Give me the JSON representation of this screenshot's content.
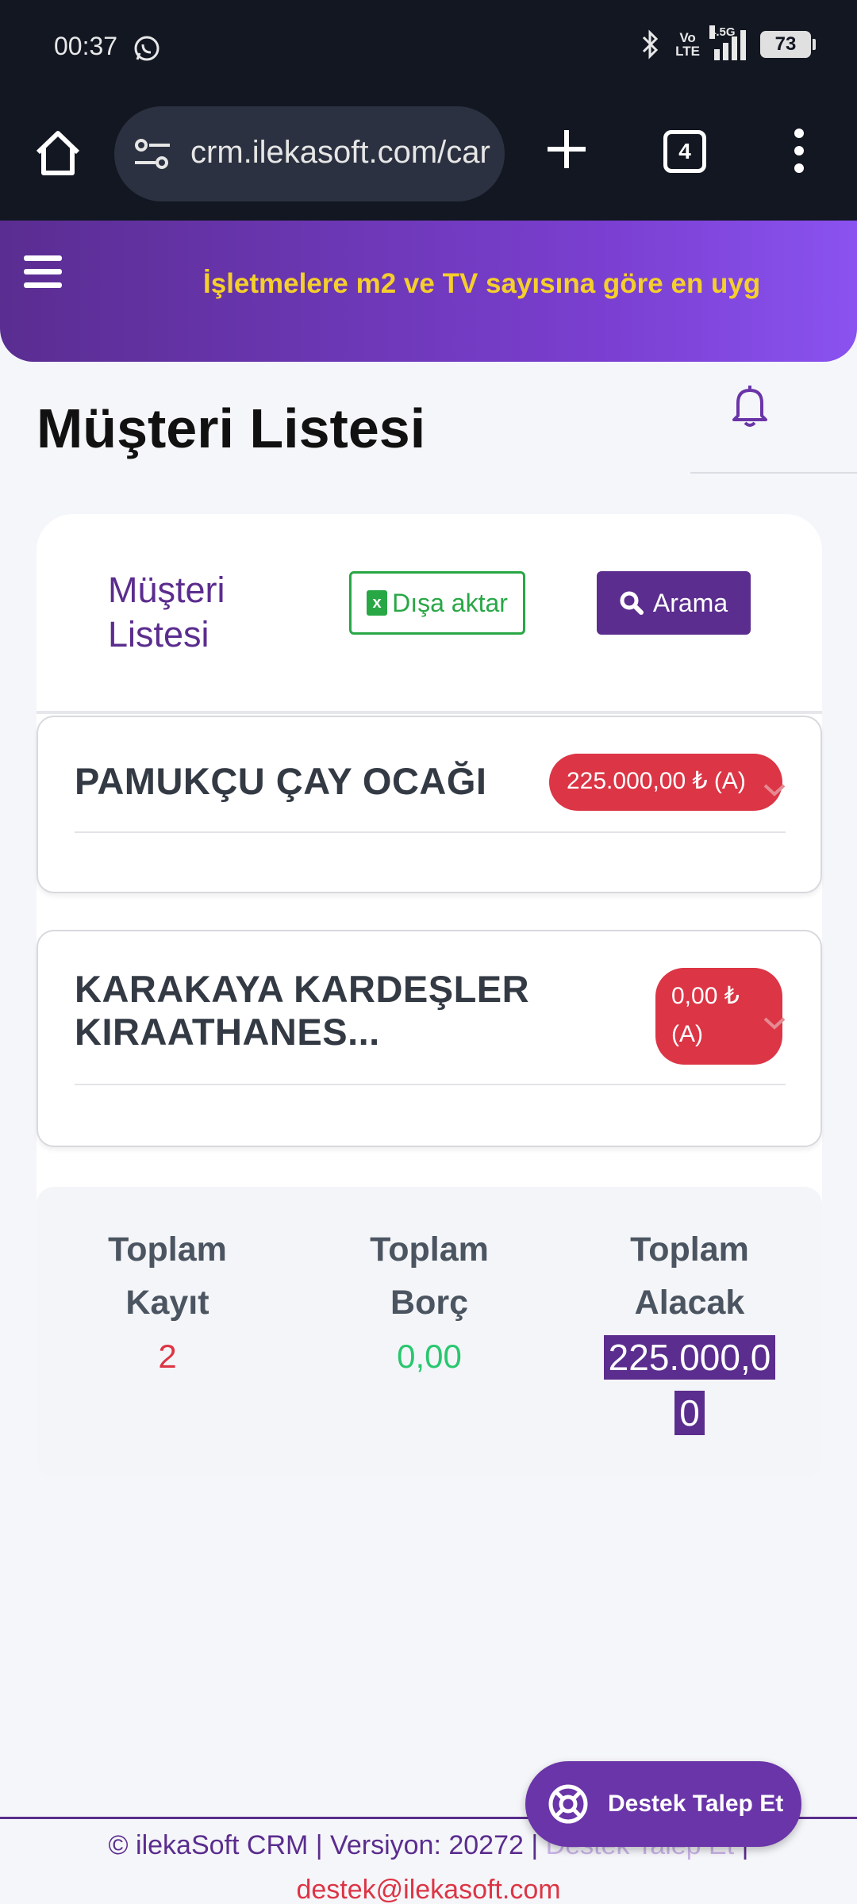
{
  "status_bar": {
    "time": "00:37",
    "volte_top": "Vo",
    "volte_bottom": "LTE",
    "network": "4.5G",
    "battery": "73"
  },
  "browser": {
    "url": "crm.ilekasoft.com/car",
    "tab_count": "4"
  },
  "header": {
    "marquee": "İşletmelere m2 ve TV sayısına göre en uyg"
  },
  "page": {
    "title": "Müşteri Listesi"
  },
  "card": {
    "title": "Müşteri Listesi",
    "export_label": "Dışa aktar",
    "search_label": "Arama"
  },
  "customers": [
    {
      "name": "PAMUKÇU ÇAY OCAĞI",
      "balance": "225.000,00 ₺ (A)"
    },
    {
      "name": "KARAKAYA KARDEŞLER KIRAATHANES...",
      "balance": "0,00 ₺ (A)"
    }
  ],
  "summary": {
    "records_label": "Toplam Kayıt",
    "records_value": "2",
    "debt_label": "Toplam Borç",
    "debt_value": "0,00",
    "credit_label": "Toplam Alacak",
    "credit_value": "225.000,00"
  },
  "footer": {
    "copyright": "© ilekaSoft CRM | Versiyon: 20272 |",
    "support_link": "Destek Talep Et",
    "separator": "|",
    "email": "destek@ilekasoft.com"
  },
  "support_button": {
    "label": "Destek Talep Et"
  },
  "colors": {
    "brand_purple": "#5b2d8e",
    "danger": "#dc3545",
    "success": "#28a745",
    "marquee_yellow": "#f5cf2b"
  },
  "icons": [
    "whatsapp-icon",
    "bluetooth-icon",
    "home-icon",
    "tune-icon",
    "plus-icon",
    "more-vert-icon",
    "hamburger-icon",
    "bell-icon",
    "excel-icon",
    "search-icon",
    "chevron-down-icon",
    "lifebuoy-icon"
  ]
}
